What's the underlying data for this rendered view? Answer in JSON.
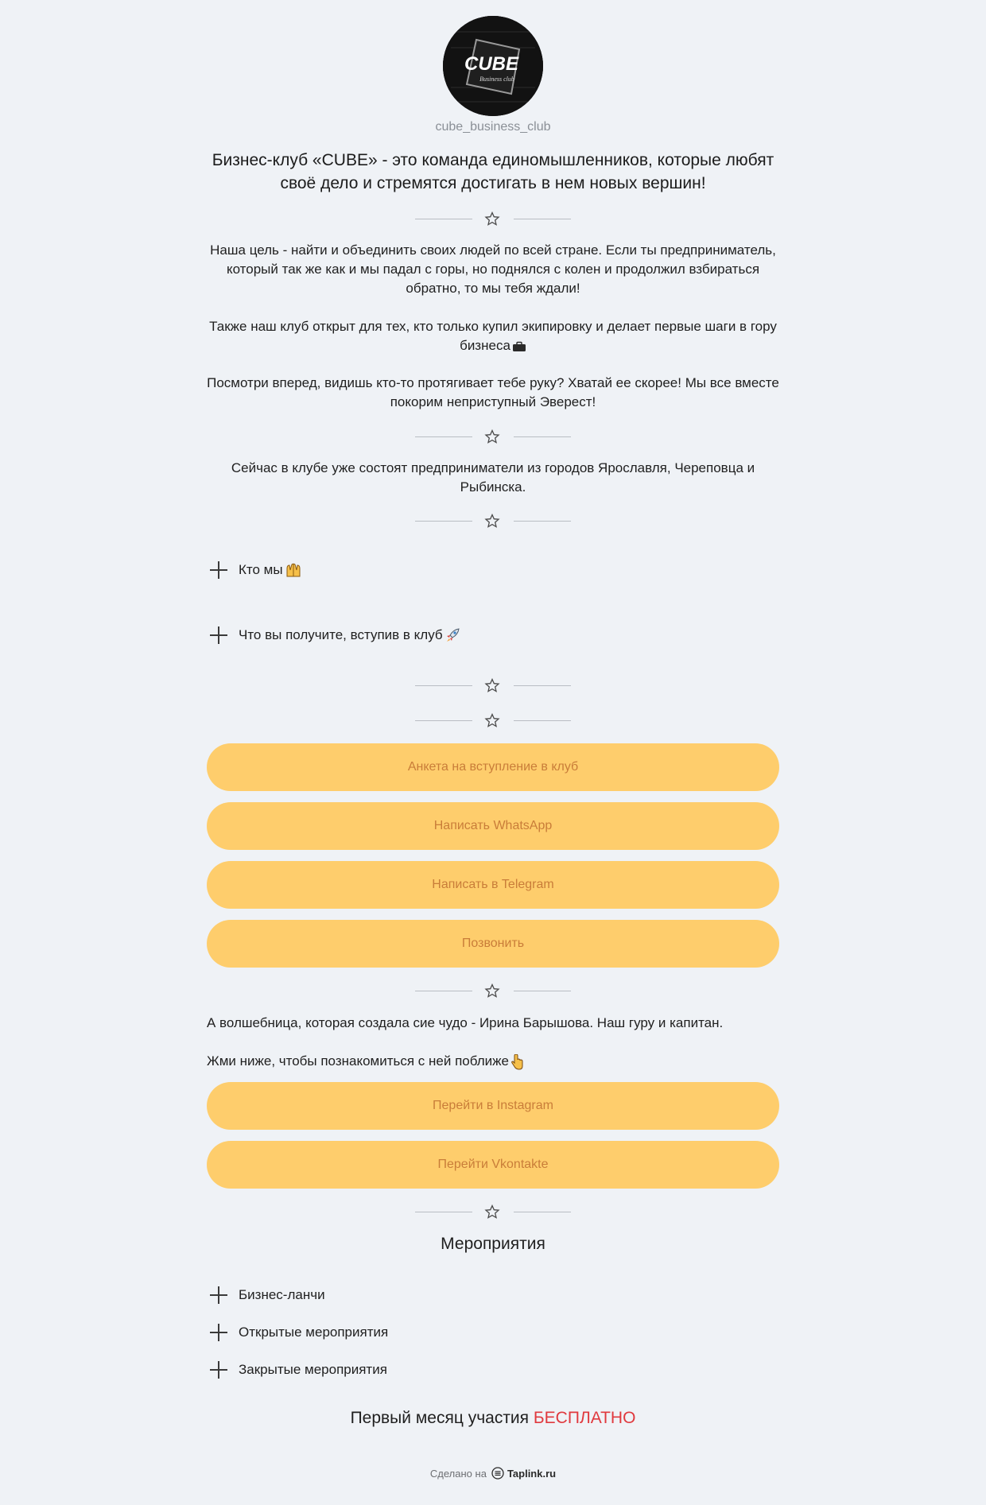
{
  "profile": {
    "username": "cube_business_club",
    "avatar_text": "CUBE",
    "avatar_subtext": "Business club"
  },
  "intro": {
    "headline": "Бизнес-клуб «CUBE» - это команда единомышленников, которые любят своё дело и стремятся достигать в нем новых вершин!",
    "p1": "Наша цель - найти и объединить своих людей по всей стране. Если ты предприниматель, который так же как и мы падал с горы, но поднялся с колен и продолжил взбираться обратно, то мы тебя ждали!",
    "p2": "Также наш клуб открыт для тех, кто только купил экипировку и делает первые шаги в гору бизнеса",
    "p3": "Посмотри вперед, видишь кто-то протягивает тебе руку? Хватай ее скорее! Мы все вместе покорим неприступный Эверест!",
    "cities": "Сейчас в клубе уже состоят предприниматели из городов Ярославля, Череповца и Рыбинска."
  },
  "accordion_top": [
    {
      "label": "Кто мы"
    },
    {
      "label": "Что вы получите, вступив в клуб"
    }
  ],
  "buttons_main": [
    {
      "label": "Анкета на вступление в клуб"
    },
    {
      "label": "Написать WhatsApp"
    },
    {
      "label": "Написать в Telegram"
    },
    {
      "label": "Позвонить"
    }
  ],
  "creator": {
    "text": "А волшебница, которая создала сие чудо - Ирина Барышова. Наш гуру и капитан.",
    "cta": "Жми ниже, чтобы познакомиться с ней поближе"
  },
  "buttons_social": [
    {
      "label": "Перейти в Instagram"
    },
    {
      "label": "Перейти Vkontakte"
    }
  ],
  "events": {
    "title": "Мероприятия",
    "items": [
      {
        "label": "Бизнес-ланчи"
      },
      {
        "label": "Открытые мероприятия"
      },
      {
        "label": "Закрытые мероприятия"
      }
    ]
  },
  "promo": {
    "text": "Первый месяц участия",
    "highlight": "БЕСПЛАТНО"
  },
  "footer": {
    "made_on": "Сделано на",
    "brand": "Taplink.ru"
  },
  "colors": {
    "background": "#eff2f6",
    "button_bg": "#fecd6c",
    "button_text": "#c97d39",
    "highlight": "#e0393e"
  }
}
